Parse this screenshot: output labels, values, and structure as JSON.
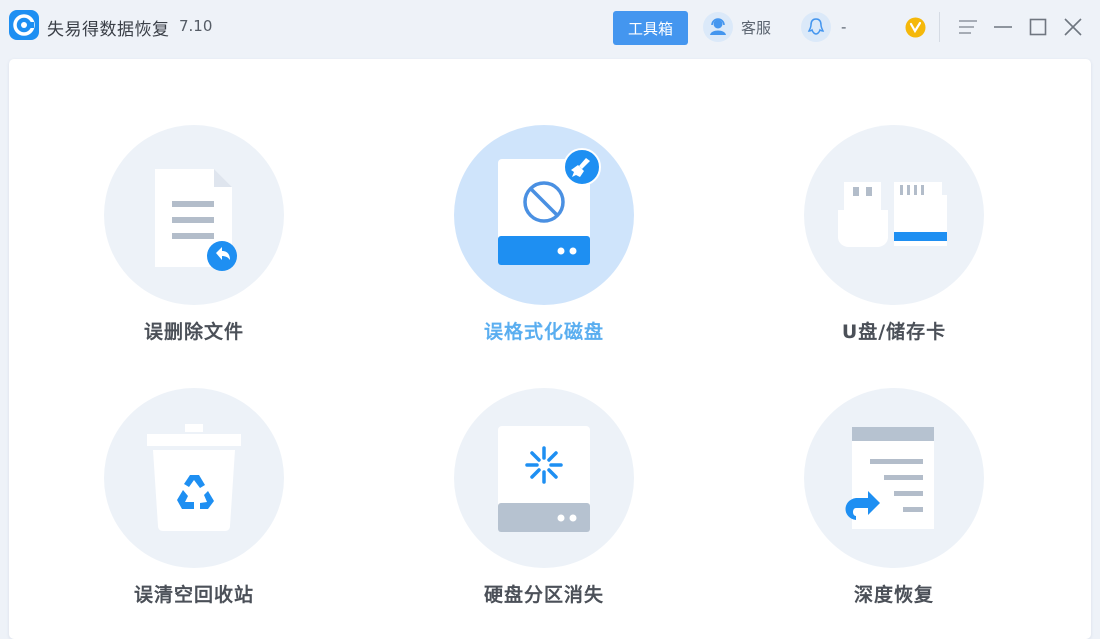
{
  "app": {
    "title": "失易得数据恢复",
    "version": "7.10"
  },
  "header": {
    "toolbox_label": "工具箱",
    "service_label": "客服",
    "qq_label": "-",
    "icons": [
      "app-logo-icon",
      "customer-service-icon",
      "qq-icon",
      "vip-icon",
      "menu-icon",
      "minimize-icon",
      "maximize-icon",
      "close-icon"
    ]
  },
  "colors": {
    "accent": "#1e8ff2",
    "toolbox_button": "#4496ef",
    "active_label": "#5aaef0",
    "active_disc": "#cfe4fb",
    "disc": "#edf2f8"
  },
  "modes": [
    {
      "label": "误删除文件",
      "icon": "deleted-file-icon",
      "active": false
    },
    {
      "label": "误格式化磁盘",
      "icon": "formatted-disk-icon",
      "active": true
    },
    {
      "label": "U盘/储存卡",
      "icon": "usb-sdcard-icon",
      "active": false
    },
    {
      "label": "误清空回收站",
      "icon": "recycle-bin-icon",
      "active": false
    },
    {
      "label": "硬盘分区消失",
      "icon": "lost-partition-icon",
      "active": false
    },
    {
      "label": "深度恢复",
      "icon": "deep-recovery-icon",
      "active": false
    }
  ]
}
